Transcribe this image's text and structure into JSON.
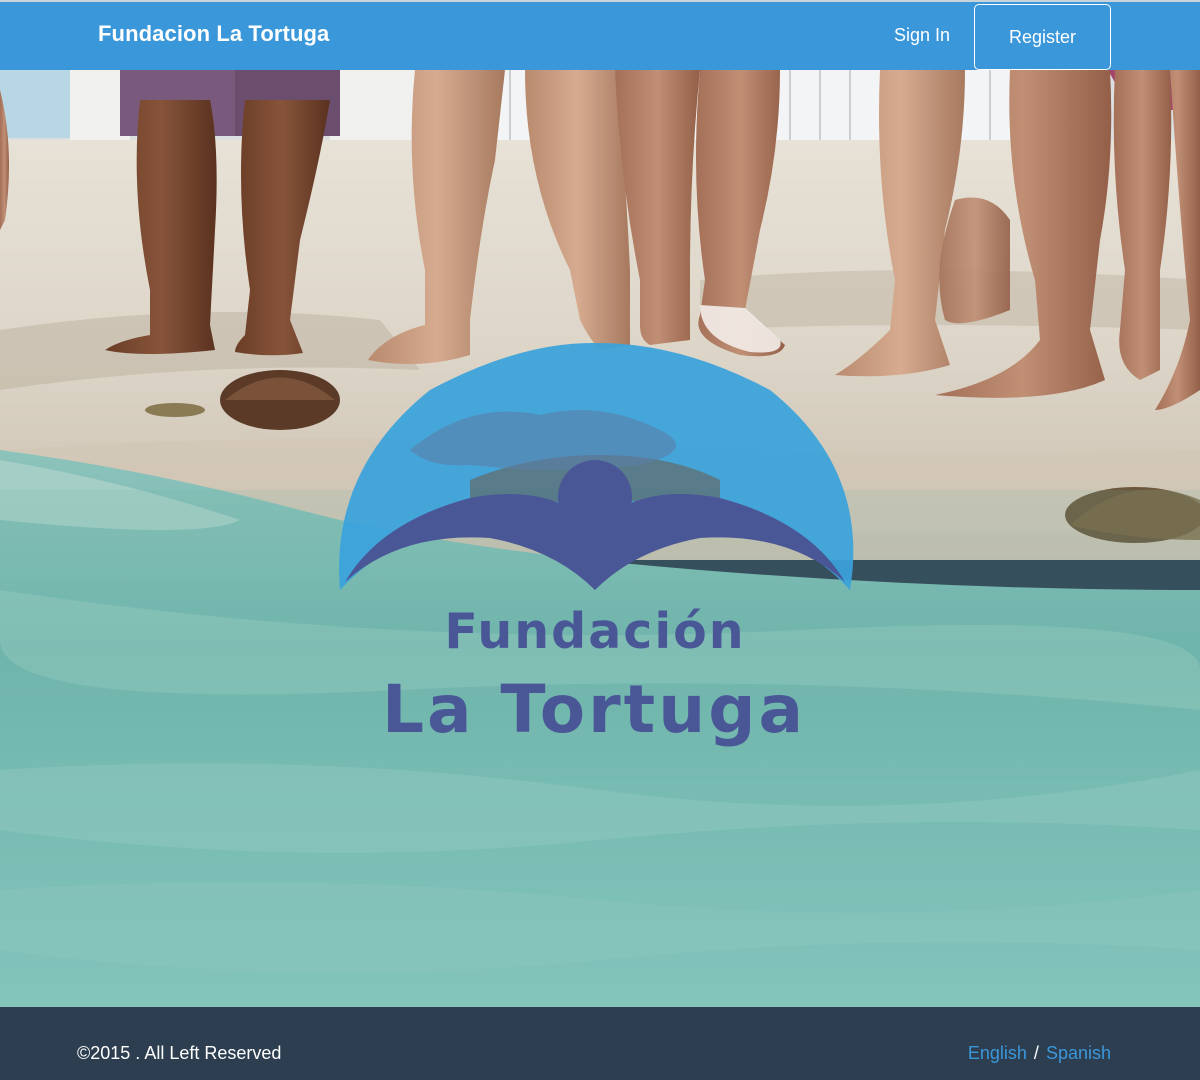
{
  "navbar": {
    "brand": "Fundacion La Tortuga",
    "sign_in": "Sign In",
    "register": "Register"
  },
  "hero": {
    "logo": {
      "line1": "Fundación",
      "line2": "La Tortuga"
    }
  },
  "footer": {
    "copyright": "©2015 . All Left Reserved",
    "lang_english": "English",
    "lang_separator": "/",
    "lang_spanish": "Spanish"
  },
  "colors": {
    "navbar": "#3a97da",
    "footer": "#2c3e50",
    "logo_light": "#3aa3db",
    "logo_dark": "#4a5797",
    "link": "#3a97da"
  },
  "icons": [
    "turtle-icon"
  ]
}
